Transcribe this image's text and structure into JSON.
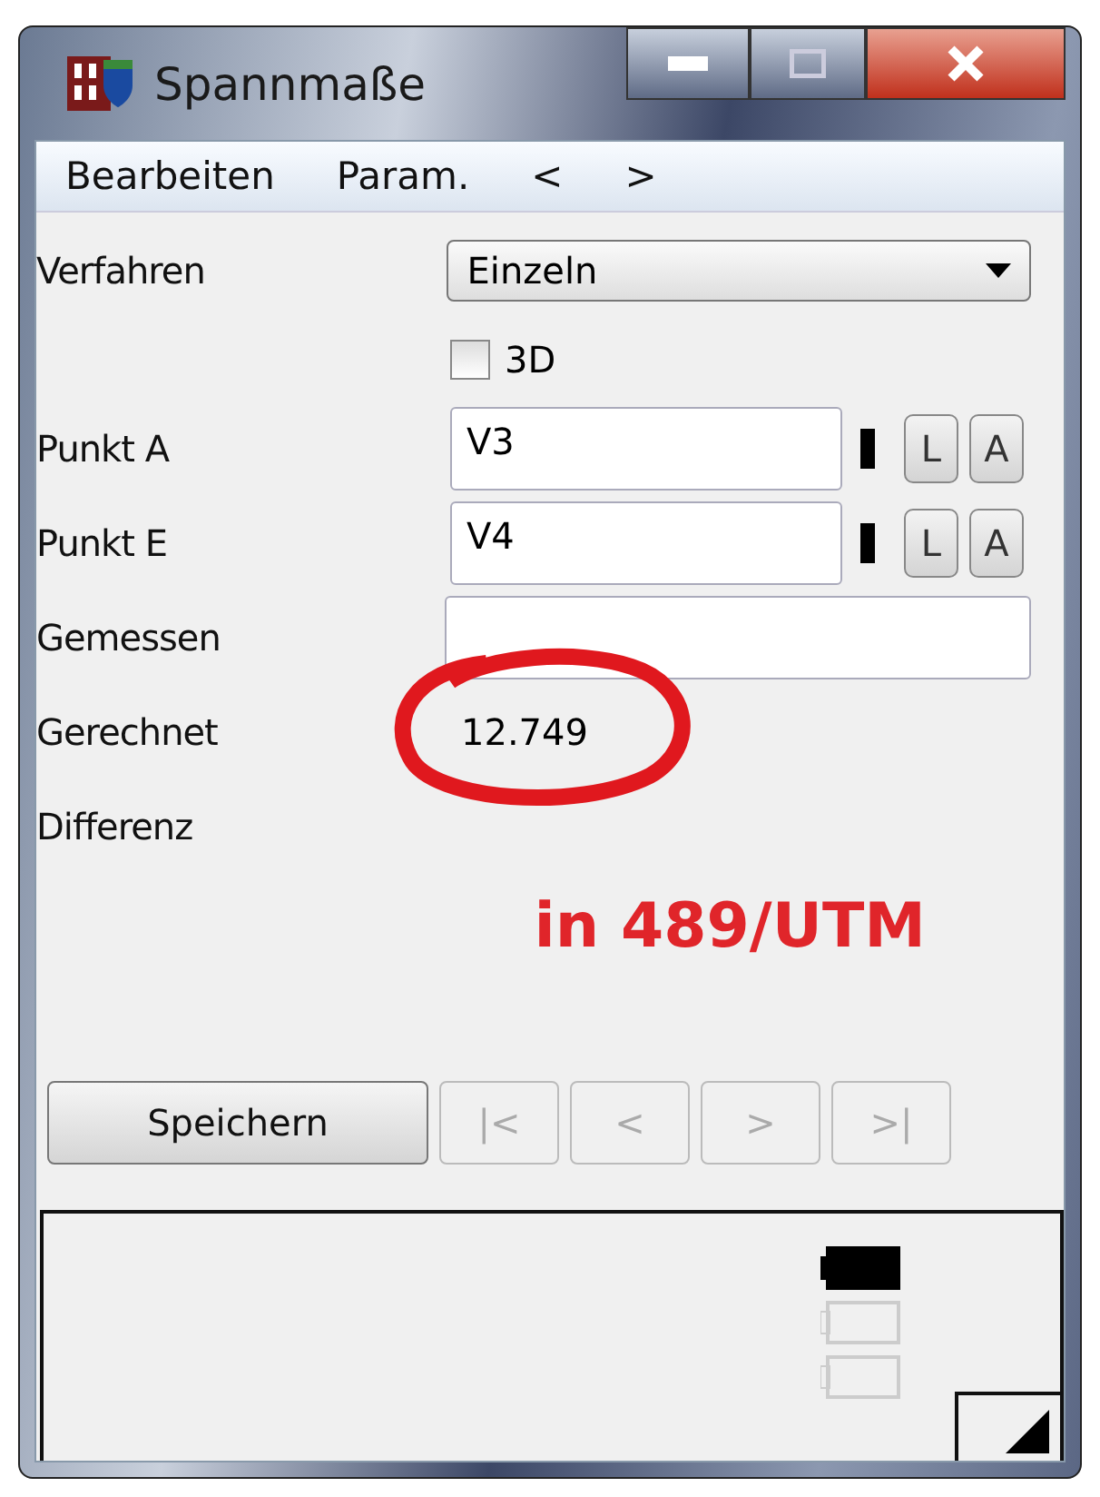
{
  "window": {
    "title": "Spannmaße"
  },
  "menu": [
    {
      "label": "Bearbeiten"
    },
    {
      "label": "Param."
    },
    {
      "label": "<"
    },
    {
      "label": ">"
    }
  ],
  "method": {
    "label": "Verfahren",
    "value": "Einzeln"
  },
  "option_3d": {
    "label": "3D",
    "checked": false
  },
  "points": [
    {
      "label": "Punkt A",
      "value": "V3",
      "buttons": [
        "L",
        "A"
      ]
    },
    {
      "label": "Punkt E",
      "value": "V4",
      "buttons": [
        "L",
        "A"
      ]
    }
  ],
  "measured": {
    "label": "Gemessen"
  },
  "computed": {
    "label": "Gerechnet",
    "value": "12.749"
  },
  "difference": {
    "label": "Differenz"
  },
  "annotation": "in 489/UTM",
  "save_button": "Speichern",
  "nav_buttons": [
    {
      "label": "|<",
      "disabled": true
    },
    {
      "label": "<",
      "disabled": true
    },
    {
      "label": ">",
      "disabled": true
    },
    {
      "label": ">|",
      "disabled": true
    }
  ],
  "indicators": [
    {
      "on": true
    },
    {
      "on": false
    },
    {
      "on": false
    }
  ]
}
